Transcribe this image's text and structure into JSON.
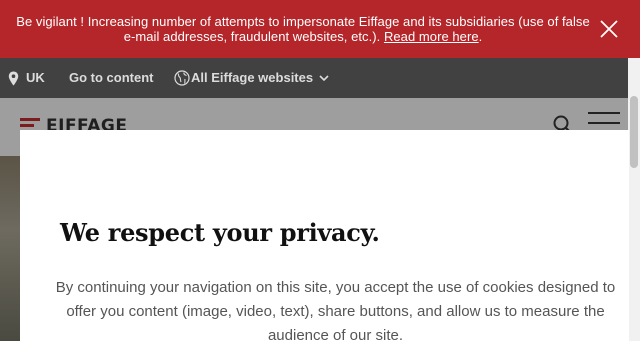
{
  "alert": {
    "message": "Be vigilant ! Increasing number of attempts to impersonate Eiffage and its subsidiaries (use of false e-mail addresses, fraudulent websites, etc.).",
    "link_text": "Read more here",
    "trailing": ".",
    "close_icon": "close-icon",
    "background": "#b4262a"
  },
  "utility_bar": {
    "location_label": "UK",
    "go_to_content": "Go to content",
    "all_websites": "All Eiffage websites",
    "background": "#414141"
  },
  "header": {
    "logo_text": "EIFFAGE",
    "search_icon": "search-icon",
    "menu_icon": "hamburger-menu-icon"
  },
  "modal": {
    "title": "We respect your privacy.",
    "body": "By continuing your navigation on this site, you accept the use of cookies designed to offer you content (image, video, text), share buttons, and allow us to measure the audience of our site."
  }
}
